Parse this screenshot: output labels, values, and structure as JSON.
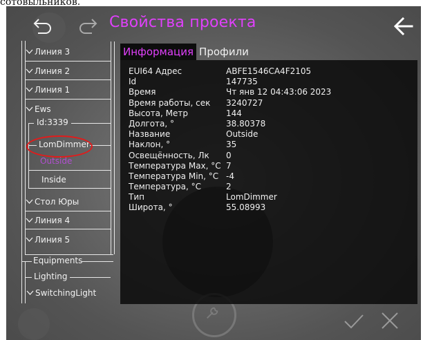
{
  "caption": "сотовыльников.",
  "header": {
    "title": "Свойства проекта",
    "undo_icon": "undo-icon",
    "redo_icon": "redo-icon",
    "back_icon": "back-arrow-icon"
  },
  "colors": {
    "accent": "#e040fb",
    "highlight_ring": "#e21b1b",
    "panel_bg": "#0a0a0a"
  },
  "tree": {
    "items": [
      {
        "label": "Линия 3"
      },
      {
        "label": "Линия 2"
      },
      {
        "label": "Линия 1"
      },
      {
        "label": "Ews"
      }
    ],
    "group": {
      "label": "Id:3339",
      "children": [
        {
          "label": "LomDimmer",
          "state": "highlighted"
        },
        {
          "label": "Outside",
          "state": "selected"
        },
        {
          "label": "Inside",
          "state": "normal"
        }
      ]
    },
    "items_after": [
      {
        "label": "Стол Юры"
      },
      {
        "label": "Линия 4"
      },
      {
        "label": "Линия 5"
      }
    ],
    "bottom_groups": [
      {
        "label": "Equipments"
      },
      {
        "label": "Lighting"
      },
      {
        "label": "SwitchingLight"
      }
    ]
  },
  "tabs": [
    {
      "label": "Информация",
      "active": true
    },
    {
      "label": "Профили",
      "active": false
    }
  ],
  "properties": [
    {
      "key": "EUI64 Адрес",
      "value": "ABFE1546CA4F2105"
    },
    {
      "key": "Id",
      "value": "147735"
    },
    {
      "key": "Время",
      "value": "Чт янв 12 04:43:06 2023"
    },
    {
      "key": "Время работы, сек",
      "value": "3240727"
    },
    {
      "key": "Высота, Метр",
      "value": "144"
    },
    {
      "key": "Долгота, °",
      "value": "38.80378"
    },
    {
      "key": "Название",
      "value": "Outside"
    },
    {
      "key": "Наклон, °",
      "value": "35"
    },
    {
      "key": "Освещённость, Лк",
      "value": "0"
    },
    {
      "key": "Температура Max, °C",
      "value": "7"
    },
    {
      "key": "Температура Min, °C",
      "value": "-4"
    },
    {
      "key": "Температура, °C",
      "value": "2"
    },
    {
      "key": "Тип",
      "value": "LomDimmer"
    },
    {
      "key": "Широта, °",
      "value": "55.08993"
    }
  ],
  "footer": {
    "confirm_icon": "check-icon",
    "cancel_icon": "close-icon"
  }
}
